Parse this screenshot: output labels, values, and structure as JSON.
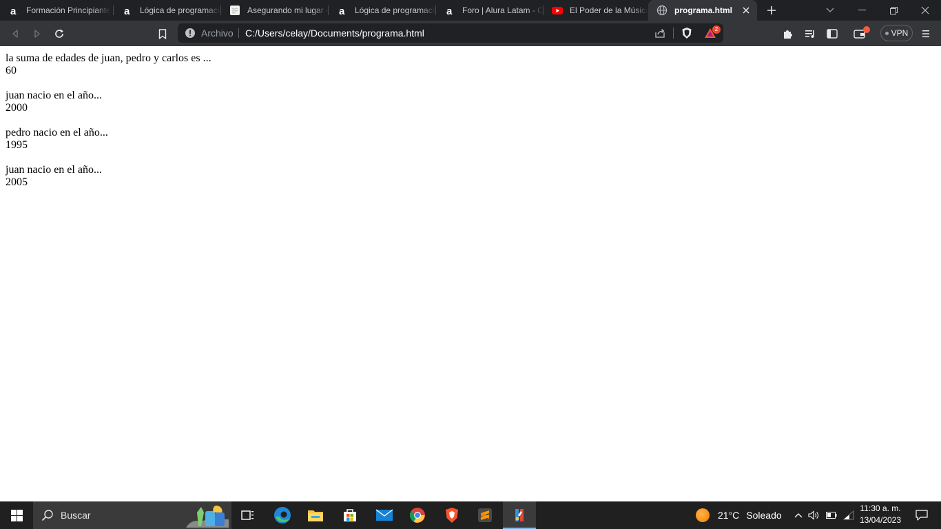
{
  "browser": {
    "tabs": [
      {
        "title": "Formación Principiante",
        "icon": "alura-icon",
        "active": false
      },
      {
        "title": "Lógica de programación",
        "icon": "alura-icon",
        "active": false
      },
      {
        "title": "Asegurando mi lugar en",
        "icon": "document-icon",
        "active": false
      },
      {
        "title": "Lógica de programación",
        "icon": "alura-icon",
        "active": false
      },
      {
        "title": "Foro | Alura Latam - Cu",
        "icon": "alura-icon",
        "active": false
      },
      {
        "title": "El Poder de la Música en",
        "icon": "youtube-icon",
        "active": false
      },
      {
        "title": "programa.html",
        "icon": "globe-icon",
        "active": true
      }
    ],
    "address_bar": {
      "scheme_label": "Archivo",
      "url": "C:/Users/celay/Documents/programa.html"
    },
    "rewards_badge": "2",
    "vpn_label": "VPN"
  },
  "page": {
    "blocks": [
      {
        "label": "la suma de edades de juan, pedro y carlos es ...",
        "value": "60"
      },
      {
        "label": "juan nacio en el año...",
        "value": "2000"
      },
      {
        "label": "pedro nacio en el año...",
        "value": "1995"
      },
      {
        "label": "juan nacio en el año...",
        "value": "2005"
      }
    ]
  },
  "taskbar": {
    "search_placeholder": "Buscar",
    "apps": [
      "task-view",
      "edge",
      "file-explorer",
      "microsoft-store",
      "mail",
      "chrome",
      "brave",
      "sublime-text",
      "paint"
    ],
    "weather": {
      "temperature": "21°C",
      "condition": "Soleado"
    },
    "clock": {
      "time": "11:30 a. m.",
      "date": "13/04/2023"
    }
  },
  "colors": {
    "tab_strip": "#202124",
    "toolbar": "#35363a",
    "omnibox": "#202124",
    "taskbar": "#202020",
    "brave_orange": "#fb542b"
  }
}
